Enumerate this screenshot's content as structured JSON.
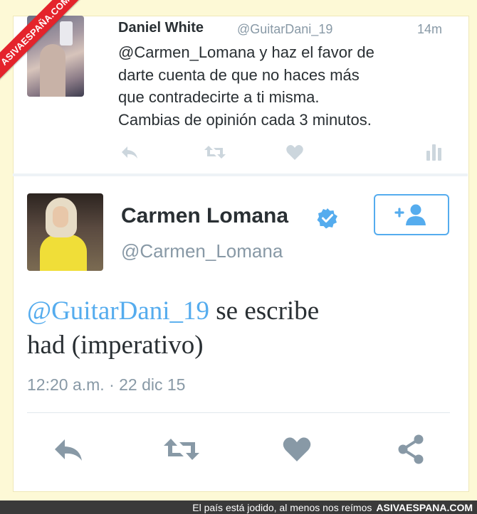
{
  "watermark": {
    "logo_text": "ASIVAESPAÑA.COM"
  },
  "tweet_reply": {
    "name": "Daniel White",
    "handle": "@GuitarDani_19",
    "time": "14m",
    "lines": [
      "@Carmen_Lomana y haz el favor de",
      "darte cuenta de que no haces más",
      "que contradecirte a ti misma.",
      "Cambias de opinión cada 3 minutos."
    ],
    "actions": [
      "reply-icon",
      "retweet-icon",
      "like-icon",
      "analytics-icon"
    ]
  },
  "tweet_main": {
    "name": "Carmen Lomana",
    "handle": "@Carmen_Lomana",
    "verified": true,
    "mention": "@GuitarDani_19",
    "text_rest_line1": " se escribe",
    "text_line2": "had (imperativo)",
    "timestamp": "12:20 a.m. · 22 dic 15",
    "actions": [
      "reply-icon",
      "retweet-icon",
      "like-icon",
      "share-icon"
    ]
  },
  "colors": {
    "accent": "#55acee",
    "icon_gray": "#8899a6",
    "icon_light": "#ccd6dd",
    "background": "#fdf9d6",
    "footer_bg": "#3a3a3a",
    "logo_red": "#e4232b"
  },
  "footer": {
    "caption": "El país está jodido, al menos nos reímos",
    "brand": "ASIVAESPANA.COM"
  }
}
